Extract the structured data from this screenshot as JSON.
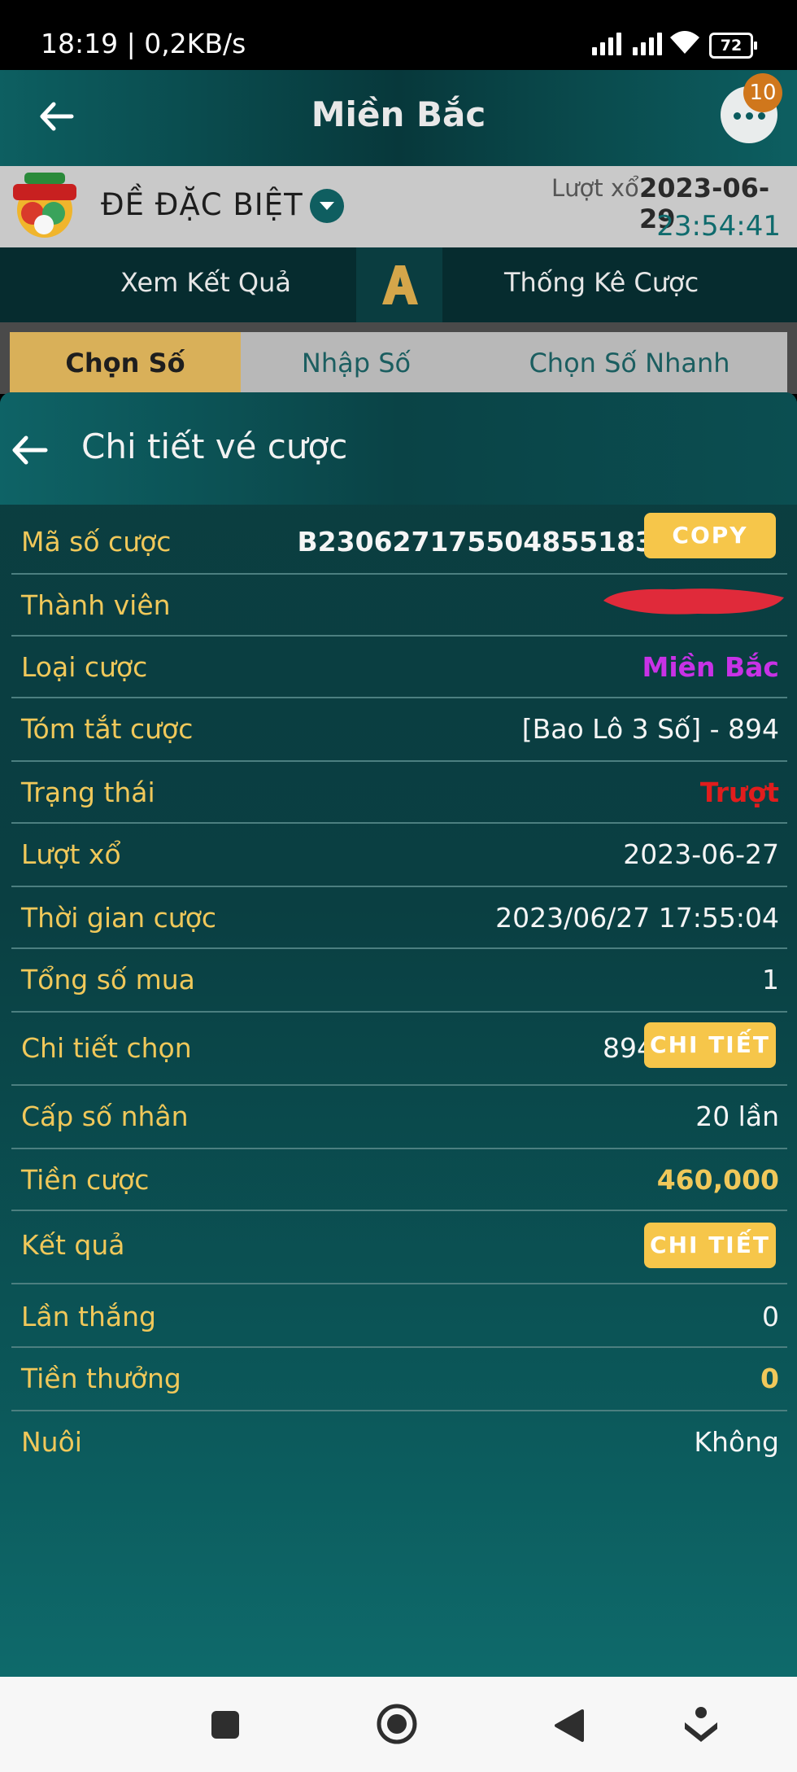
{
  "status_bar": {
    "time": "18:19 | 0,2KB/s",
    "battery": "72"
  },
  "header": {
    "title": "Miền Bắc",
    "notification_count": "10"
  },
  "lottery_bar": {
    "game_name": "ĐỀ ĐẶC BIỆT",
    "draw_label": "Lượt xổ",
    "draw_date": "2023-06-29",
    "countdown": "23:54:41"
  },
  "action_bar": {
    "left": "Xem Kết Quả",
    "right": "Thống Kê Cược"
  },
  "tabs": [
    {
      "label": "Chọn Số",
      "active": true
    },
    {
      "label": "Nhập Số",
      "active": false
    },
    {
      "label": "Chọn Số Nhanh",
      "active": false
    }
  ],
  "detail": {
    "title": "Chi tiết vé cược",
    "copy_label": "COPY",
    "detail_button_label": "CHI TIẾT",
    "rows": [
      {
        "label": "Mã số cược",
        "value": "B230627175504855183"
      },
      {
        "label": "Thành viên",
        "value": ""
      },
      {
        "label": "Loại cược",
        "value": "Miền Bắc"
      },
      {
        "label": "Tóm tắt cược",
        "value": "[Bao Lô 3 Số] - 894"
      },
      {
        "label": "Trạng thái",
        "value": "Trượt"
      },
      {
        "label": "Lượt xổ",
        "value": "2023-06-27"
      },
      {
        "label": "Thời gian cược",
        "value": "2023/06/27 17:55:04"
      },
      {
        "label": "Tổng số mua",
        "value": "1"
      },
      {
        "label": "Chi tiết chọn",
        "value": "894"
      },
      {
        "label": "Cấp số nhân",
        "value": "20 lần"
      },
      {
        "label": "Tiền cược",
        "value": "460,000"
      },
      {
        "label": "Kết quả",
        "value": ""
      },
      {
        "label": "Lần thắng",
        "value": "0"
      },
      {
        "label": "Tiền thưởng",
        "value": "0"
      },
      {
        "label": "Nuôi",
        "value": "Không"
      }
    ]
  },
  "colors": {
    "accent_gold": "#f0c85a",
    "bet_type": "#c832e6",
    "status_lost": "#e01d1d",
    "button_yellow": "#f6c64a"
  },
  "icons": [
    "back-arrow-icon",
    "more-dots-icon",
    "lottery-logo-icon",
    "dropdown-icon",
    "logo-a-icon",
    "redaction-mark",
    "square-nav-icon",
    "home-nav-icon",
    "back-nav-icon",
    "menu-nav-icon"
  ]
}
